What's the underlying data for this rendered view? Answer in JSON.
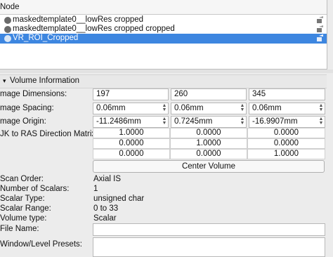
{
  "node_table": {
    "header": "Node",
    "rows": [
      {
        "label": "maskedtemplate0__lowRes cropped",
        "selected": false
      },
      {
        "label": "maskedtemplate0__lowRes cropped cropped",
        "selected": false
      },
      {
        "label": "VR_ROI_Cropped",
        "selected": true
      }
    ]
  },
  "volume_info": {
    "title": "Volume Information",
    "image_dimensions": {
      "label": "mage Dimensions:",
      "values": [
        "197",
        "260",
        "345"
      ]
    },
    "image_spacing": {
      "label": "mage Spacing:",
      "values": [
        "0.06mm",
        "0.06mm",
        "0.06mm"
      ]
    },
    "image_origin": {
      "label": "mage Origin:",
      "values": [
        "-11.2486mm",
        "0.7245mm",
        "-16.9907mm"
      ]
    },
    "ijk_matrix": {
      "label": "JK to RAS Direction Matrix:",
      "rows": [
        [
          "1.0000",
          "0.0000",
          "0.0000"
        ],
        [
          "0.0000",
          "1.0000",
          "0.0000"
        ],
        [
          "0.0000",
          "0.0000",
          "1.0000"
        ]
      ]
    },
    "center_volume_label": "Center Volume",
    "scan_order": {
      "label": "Scan Order:",
      "value": "Axial IS"
    },
    "number_of_scalars": {
      "label": "Number of Scalars:",
      "value": "1"
    },
    "scalar_type": {
      "label": "Scalar Type:",
      "value": "unsigned char"
    },
    "scalar_range": {
      "label": "Scalar Range:",
      "value": "0 to 33"
    },
    "volume_type": {
      "label": "Volume type:",
      "value": "Scalar"
    },
    "file_name": {
      "label": "File Name:",
      "value": ""
    },
    "window_level_presets": {
      "label": "Window/Level Presets:",
      "value": ""
    }
  }
}
